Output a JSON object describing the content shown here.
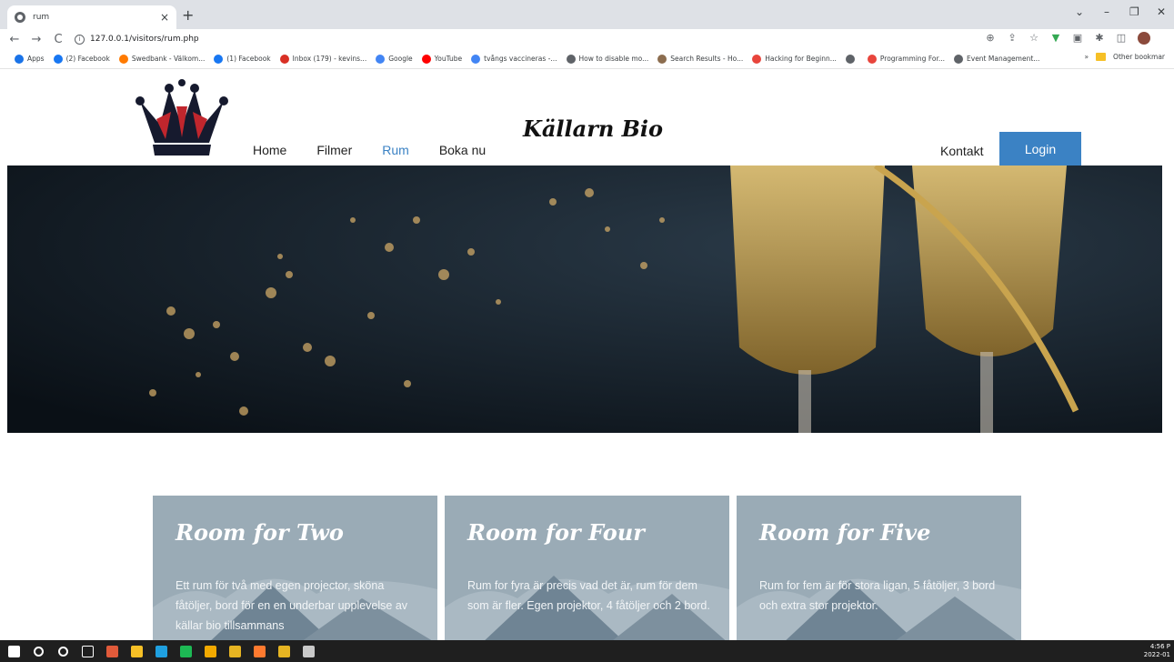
{
  "browser": {
    "tab_title": "rum",
    "tab_close": "×",
    "new_tab": "+",
    "url": "127.0.0.1/visitors/rum.php",
    "window_controls": [
      "⌄",
      "–",
      "❐",
      "✕"
    ],
    "nav": {
      "back": "←",
      "forward": "→",
      "reload": "C",
      "info": "i"
    },
    "bookmarks": [
      {
        "label": "Apps",
        "color": "#1a73e8"
      },
      {
        "label": "(2) Facebook",
        "color": "#1877f2"
      },
      {
        "label": "Swedbank - Välkom...",
        "color": "#ff7a00"
      },
      {
        "label": "(1) Facebook",
        "color": "#1877f2"
      },
      {
        "label": "Inbox (179) - kevins...",
        "color": "#d93025"
      },
      {
        "label": "Google",
        "color": "#4285f4"
      },
      {
        "label": "YouTube",
        "color": "#ff0000"
      },
      {
        "label": "tvångs vaccineras -...",
        "color": "#4285f4"
      },
      {
        "label": "How to disable mo...",
        "color": "#5f6368"
      },
      {
        "label": "Search Results - Ho...",
        "color": "#8c6d4f"
      },
      {
        "label": "Hacking for Beginn...",
        "color": "#e8453c"
      },
      {
        "label": "",
        "color": "#5f6368"
      },
      {
        "label": "Programming For...",
        "color": "#e8453c"
      },
      {
        "label": "Event Management...",
        "color": "#5f6368"
      }
    ],
    "bookmarks_more": "»",
    "other_bookmarks": "Other bookmar"
  },
  "site": {
    "brand": "Källarn Bio",
    "nav": [
      "Home",
      "Filmer",
      "Rum",
      "Boka nu"
    ],
    "active_nav": "Rum",
    "kontakt": "Kontakt",
    "login": "Login"
  },
  "cards": [
    {
      "title": "Room for Two",
      "text": "Ett rum för två med egen projector, sköna fåtöljer, bord för en en underbar upplevelse av källar bio tillsammans"
    },
    {
      "title": "Room for Four",
      "text": "Rum for fyra är precis vad det är, rum för dem som är fler. Egen projektor, 4 fåtöljer och 2 bord."
    },
    {
      "title": "Room for Five",
      "text": "Rum for fem är för stora ligan, 5 fåtöljer, 3 bord och extra stor projektor."
    }
  ],
  "colors": {
    "accent": "#3b82c4",
    "card_bg": "#9aabb6"
  },
  "taskbar": {
    "icons": [
      {
        "name": "windows-icon",
        "color": "#ffffff"
      },
      {
        "name": "search-icon",
        "color": "#ffffff"
      },
      {
        "name": "cortana-icon",
        "color": "#ffffff"
      },
      {
        "name": "task-view-icon",
        "color": "#ffffff"
      },
      {
        "name": "app-icon",
        "color": "#e05a3a"
      },
      {
        "name": "file-explorer-icon",
        "color": "#f6c026"
      },
      {
        "name": "edge-icon",
        "color": "#1fa0e0"
      },
      {
        "name": "spotify-icon",
        "color": "#1db954"
      },
      {
        "name": "chrome-icon",
        "color": "#f2a900"
      },
      {
        "name": "wamp-icon",
        "color": "#e6b422"
      },
      {
        "name": "sublime-icon",
        "color": "#ff7a2f"
      },
      {
        "name": "calendar-icon",
        "color": "#e6b422"
      },
      {
        "name": "paint-icon",
        "color": "#c9c9c9"
      }
    ],
    "time": "4:56 P",
    "date": "2022-01"
  }
}
